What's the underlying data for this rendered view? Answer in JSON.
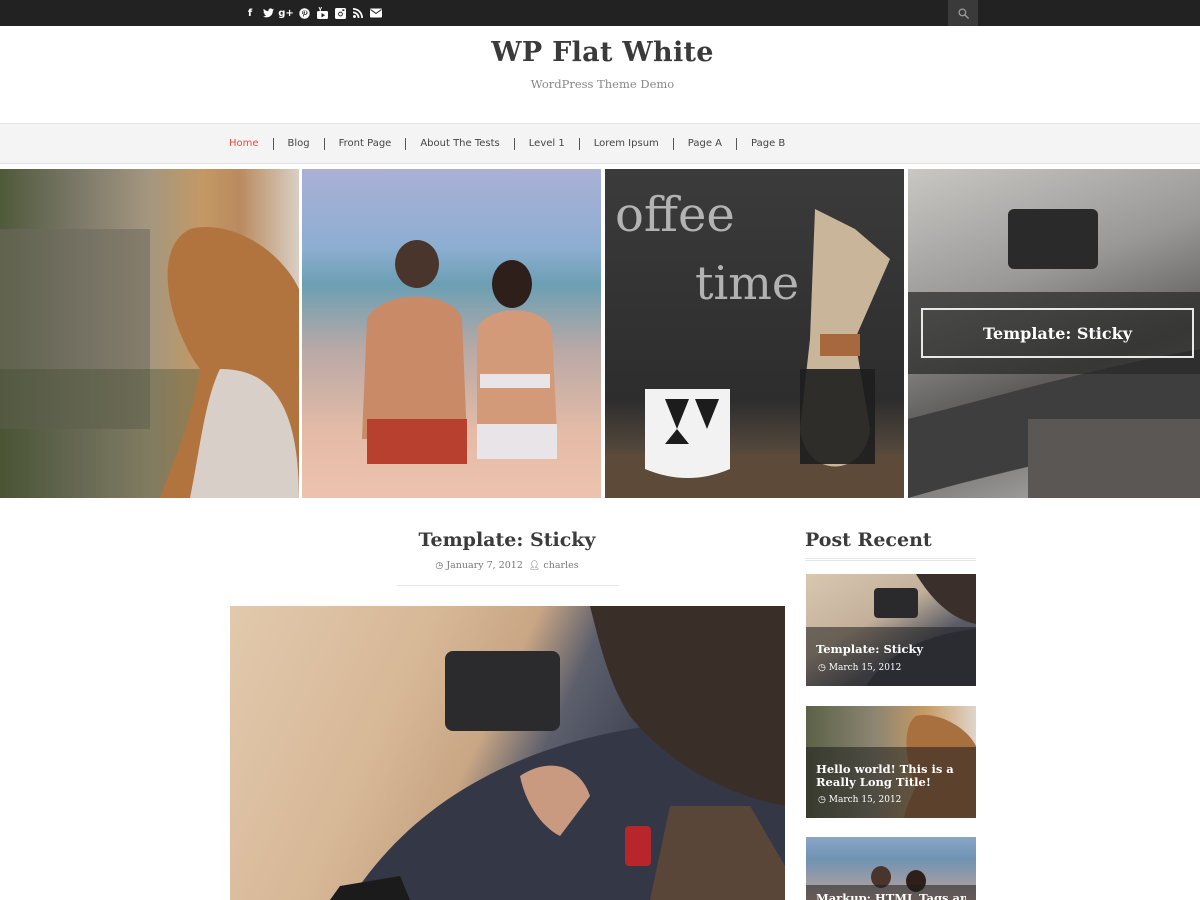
{
  "topbar": {
    "social": [
      {
        "icon": "facebook-icon",
        "glyph": "f"
      },
      {
        "icon": "twitter-icon",
        "glyph": "t"
      },
      {
        "icon": "googleplus-icon",
        "glyph": "g+"
      },
      {
        "icon": "pinterest-icon",
        "glyph": "p"
      },
      {
        "icon": "youtube-icon",
        "glyph": "▶"
      },
      {
        "icon": "instagram-icon",
        "glyph": "◘"
      },
      {
        "icon": "rss-icon",
        "glyph": "≋"
      },
      {
        "icon": "email-icon",
        "glyph": "✉"
      }
    ],
    "search_icon": "search-icon"
  },
  "header": {
    "title": "WP Flat White",
    "description": "WordPress Theme Demo"
  },
  "nav": {
    "items": [
      "Home",
      "Blog",
      "Front Page",
      "About The Tests",
      "Level 1",
      "Lorem Ipsum",
      "Page A",
      "Page B"
    ],
    "active": "Home",
    "active_color": "#e74c3c"
  },
  "slider": {
    "caption": "Template: Sticky"
  },
  "post": {
    "title": "Template: Sticky",
    "date": "January 7, 2012",
    "author": "charles"
  },
  "sidebar": {
    "title": "Post Recent",
    "posts": [
      {
        "title": "Template: Sticky",
        "date": "March 15, 2012"
      },
      {
        "title": "Hello world! This is a Really Long Title!",
        "date": "March 15, 2012"
      },
      {
        "title": "Markup: HTML Tags and Formatting",
        "date": ""
      }
    ]
  }
}
